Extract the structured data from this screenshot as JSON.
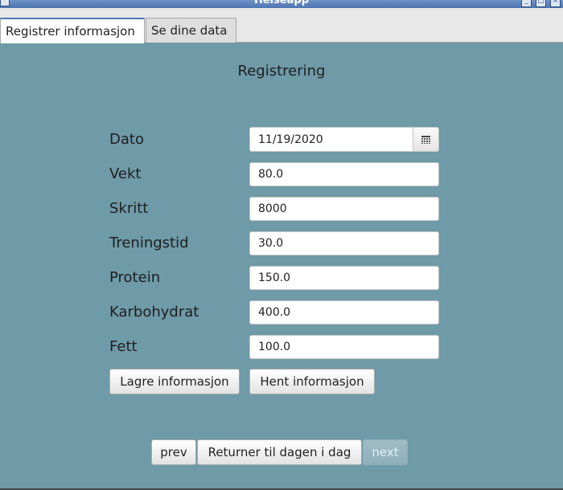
{
  "window": {
    "title": "Helseapp"
  },
  "tabs": [
    {
      "label": "Registrer informasjon",
      "active": true
    },
    {
      "label": "Se dine data",
      "active": false
    }
  ],
  "form": {
    "heading": "Registrering",
    "fields": {
      "dato": {
        "label": "Dato",
        "value": "11/19/2020"
      },
      "vekt": {
        "label": "Vekt",
        "value": "80.0"
      },
      "skritt": {
        "label": "Skritt",
        "value": "8000"
      },
      "treningstid": {
        "label": "Treningstid",
        "value": "30.0"
      },
      "protein": {
        "label": "Protein",
        "value": "150.0"
      },
      "karbohydrat": {
        "label": "Karbohydrat",
        "value": "400.0"
      },
      "fett": {
        "label": "Fett",
        "value": "100.0"
      }
    },
    "save_label": "Lagre informasjon",
    "fetch_label": "Hent informasjon"
  },
  "navigation": {
    "prev_label": "prev",
    "today_label": "Returner til dagen i dag",
    "next_label": "next",
    "next_enabled": false
  },
  "icons": {
    "calendar": "calendar-icon"
  },
  "colors": {
    "background": "#6f9aa8",
    "tab_active_accent": "#4d79b8"
  }
}
